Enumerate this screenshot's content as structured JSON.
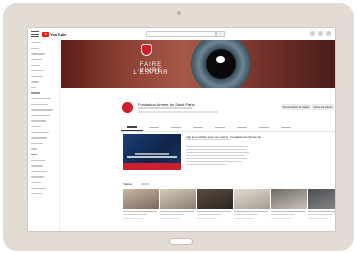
{
  "app": {
    "logo_text": "YouTube"
  },
  "banner": {
    "line1": "FAIRE VIVRE",
    "line2": "L'ESPOIR"
  },
  "channel": {
    "name": "Fondation Armée du Salut Paris",
    "buttons": [
      "Personnaliser la chaîne",
      "Gérer les vidéos"
    ]
  },
  "featured": {
    "description_title": "Agir au quotidien pour nos voisins - Fondation de l'Armée du..."
  },
  "shelf": {
    "title": "Vidéos"
  },
  "colors": {
    "brand_red": "#d21c2a",
    "youtube_red": "#e62117",
    "banner_dark": "#5e1d16"
  },
  "icons": [
    "menu-icon",
    "youtube-logo-icon",
    "search-icon",
    "apps-icon",
    "notifications-icon",
    "account-icon"
  ]
}
